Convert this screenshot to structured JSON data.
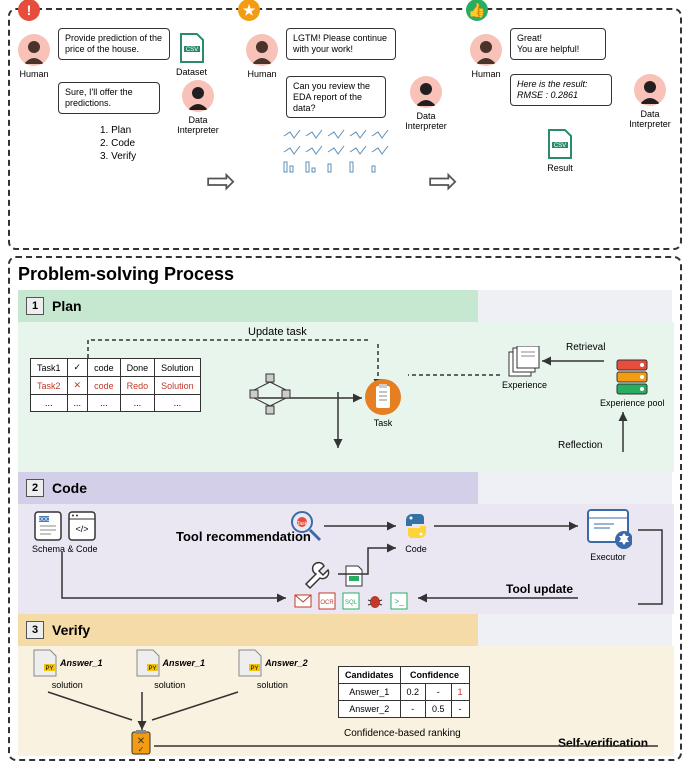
{
  "top": {
    "humanLabel": "Human",
    "diLabel": "Data Interpreter",
    "col1": {
      "humanSpeech": "Provide prediction of the price of the house.",
      "diSpeech": "Sure, I'll offer the predictions.",
      "dataset": "Dataset",
      "steps": [
        "1. Plan",
        "2. Code",
        "3. Verify"
      ]
    },
    "col2": {
      "humanSpeech": "LGTM! Please continue with your work!",
      "diSpeech": "Can you review the EDA report of the data?"
    },
    "col3": {
      "humanSpeech": "Great!\nYou are helpful!",
      "diSpeech": "Here is the result:\nRMSE : 0.2861",
      "result": "Result"
    }
  },
  "process": {
    "title": "Problem-solving Process",
    "plan": {
      "label": "Plan",
      "num": "1",
      "updateTask": "Update task",
      "table": {
        "rows": [
          [
            "Task1",
            "✓",
            "code",
            "Done",
            "Solution"
          ],
          [
            "Task2",
            "✕",
            "code",
            "Redo",
            "Solution"
          ],
          [
            "...",
            "...",
            "...",
            "...",
            "..."
          ]
        ]
      },
      "taskLabel": "Task",
      "experience": "Experience",
      "experiencePool": "Experience pool",
      "retrieval": "Retrieval",
      "reflection": "Reflection"
    },
    "code": {
      "label": "Code",
      "num": "2",
      "schemaCode": "Schema & Code",
      "toolRec": "Tool recommendation",
      "codeLabel": "Code",
      "executor": "Executor",
      "toolUpdate": "Tool update"
    },
    "verify": {
      "label": "Verify",
      "num": "3",
      "answers": [
        "Answer_1",
        "Answer_1",
        "Answer_2"
      ],
      "solution": "solution",
      "conf": {
        "headers": [
          "Candidates",
          "Confidence"
        ],
        "rows": [
          [
            "Answer_1",
            "0.2",
            "-",
            "1"
          ],
          [
            "Answer_2",
            "-",
            "0.5",
            "-"
          ]
        ]
      },
      "ranking": "Confidence-based ranking",
      "selfVerify": "Self-verification"
    }
  }
}
